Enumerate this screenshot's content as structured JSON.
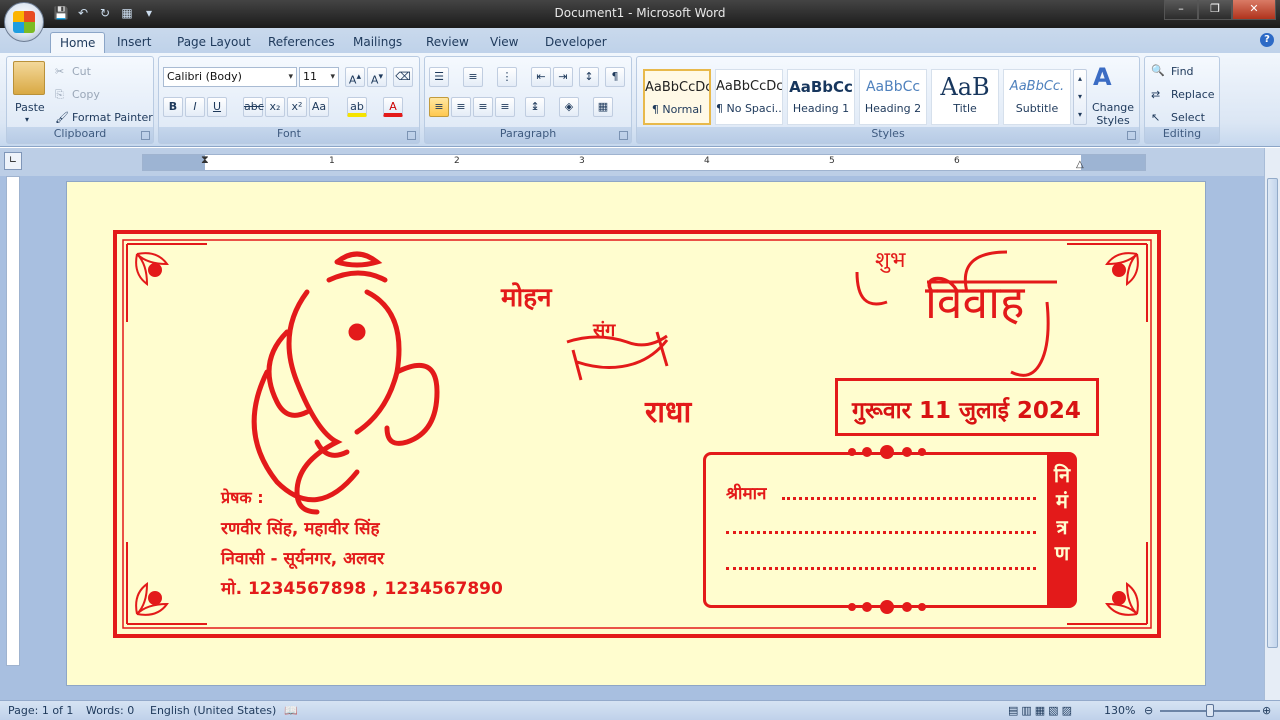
{
  "window": {
    "title": "Document1 - Microsoft Word"
  },
  "tabs": [
    "Home",
    "Insert",
    "Page Layout",
    "References",
    "Mailings",
    "Review",
    "View",
    "Developer"
  ],
  "clipboard": {
    "paste": "Paste",
    "cut": "Cut",
    "copy": "Copy",
    "format_painter": "Format Painter",
    "label": "Clipboard"
  },
  "font": {
    "name": "Calibri (Body)",
    "size": "11",
    "label": "Font"
  },
  "paragraph": {
    "label": "Paragraph"
  },
  "styles": {
    "label": "Styles",
    "tiles": [
      {
        "sample": "AaBbCcDc",
        "name": "¶ Normal"
      },
      {
        "sample": "AaBbCcDc",
        "name": "¶ No Spaci..."
      },
      {
        "sample": "AaBbCc",
        "name": "Heading 1"
      },
      {
        "sample": "AaBbCc",
        "name": "Heading 2"
      },
      {
        "sample": "AaB",
        "name": "Title"
      },
      {
        "sample": "AaBbCc.",
        "name": "Subtitle"
      }
    ],
    "change_styles": "Change Styles"
  },
  "editing": {
    "find": "Find",
    "replace": "Replace",
    "select": "Select",
    "label": "Editing"
  },
  "ruler": {
    "numbers": [
      "1",
      "2",
      "3",
      "4",
      "5",
      "6"
    ]
  },
  "card": {
    "groom": "मोहन",
    "sang": "संग",
    "bride": "राधा",
    "shubh": "शुभ",
    "vivah": "विवाह",
    "date": "गुरूवार 11 जुलाई 2024",
    "shriman": "श्रीमान",
    "nimantran": [
      "नि",
      "मं",
      "त्र",
      "ण"
    ],
    "sender_label": "प्रेषक :",
    "sender_names": "रणवीर सिंह, महावीर सिंह",
    "sender_address": "निवासी - सूर्यनगर, अलवर",
    "sender_phone": "मो. 1234567898 , 1234567890"
  },
  "status": {
    "page": "Page: 1 of 1",
    "words": "Words: 0",
    "language": "English (United States)",
    "zoom": "130%"
  },
  "colors": {
    "accent": "#e31a1a",
    "page": "#fffdcf"
  }
}
